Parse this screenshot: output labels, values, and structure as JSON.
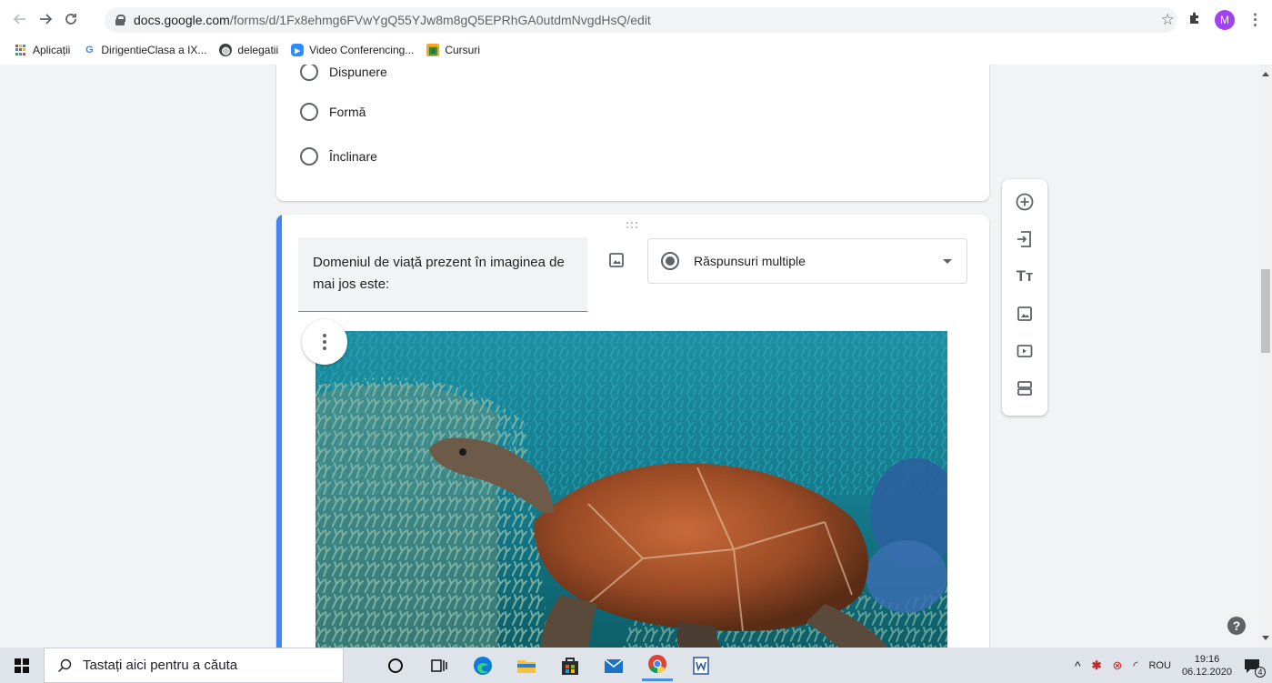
{
  "browser": {
    "url_domain": "docs.google.com",
    "url_path": "/forms/d/1Fx8ehmg6FVwYgQ55YJw8m8gQ5EPRhGA0utdmNvgdHsQ/edit",
    "profile_initial": "M",
    "bookmarks": [
      {
        "label": "Aplicații",
        "icon": "apps-grid-icon"
      },
      {
        "label": "DirigentieClasa a IX...",
        "icon": "google-g-icon"
      },
      {
        "label": "delegatii",
        "icon": "globe-icon"
      },
      {
        "label": "Video Conferencing...",
        "icon": "zoom-icon"
      },
      {
        "label": "Cursuri",
        "icon": "classroom-icon"
      }
    ]
  },
  "form": {
    "prev_question_options": [
      "Dispunere",
      "Formă",
      "Înclinare"
    ],
    "question": {
      "title": "Domeniul de viață prezent în imaginea de mai jos este:",
      "type_label": "Răspunsuri multiple",
      "image_subject": "sea-turtle-over-coral-reef"
    }
  },
  "side_toolbar": {
    "tools": [
      "add-question-icon",
      "import-questions-icon",
      "add-title-icon",
      "add-image-icon",
      "add-video-icon",
      "add-section-icon"
    ]
  },
  "taskbar": {
    "search_placeholder": "Tastați aici pentru a căuta",
    "language": "ROU",
    "time": "19:16",
    "date": "06.12.2020",
    "notification_count": "4"
  },
  "colors": {
    "accent_blue": "#4285f4",
    "card_bg": "#ffffff",
    "page_bg": "#f1f3f4",
    "profile_purple": "#a142f4"
  }
}
